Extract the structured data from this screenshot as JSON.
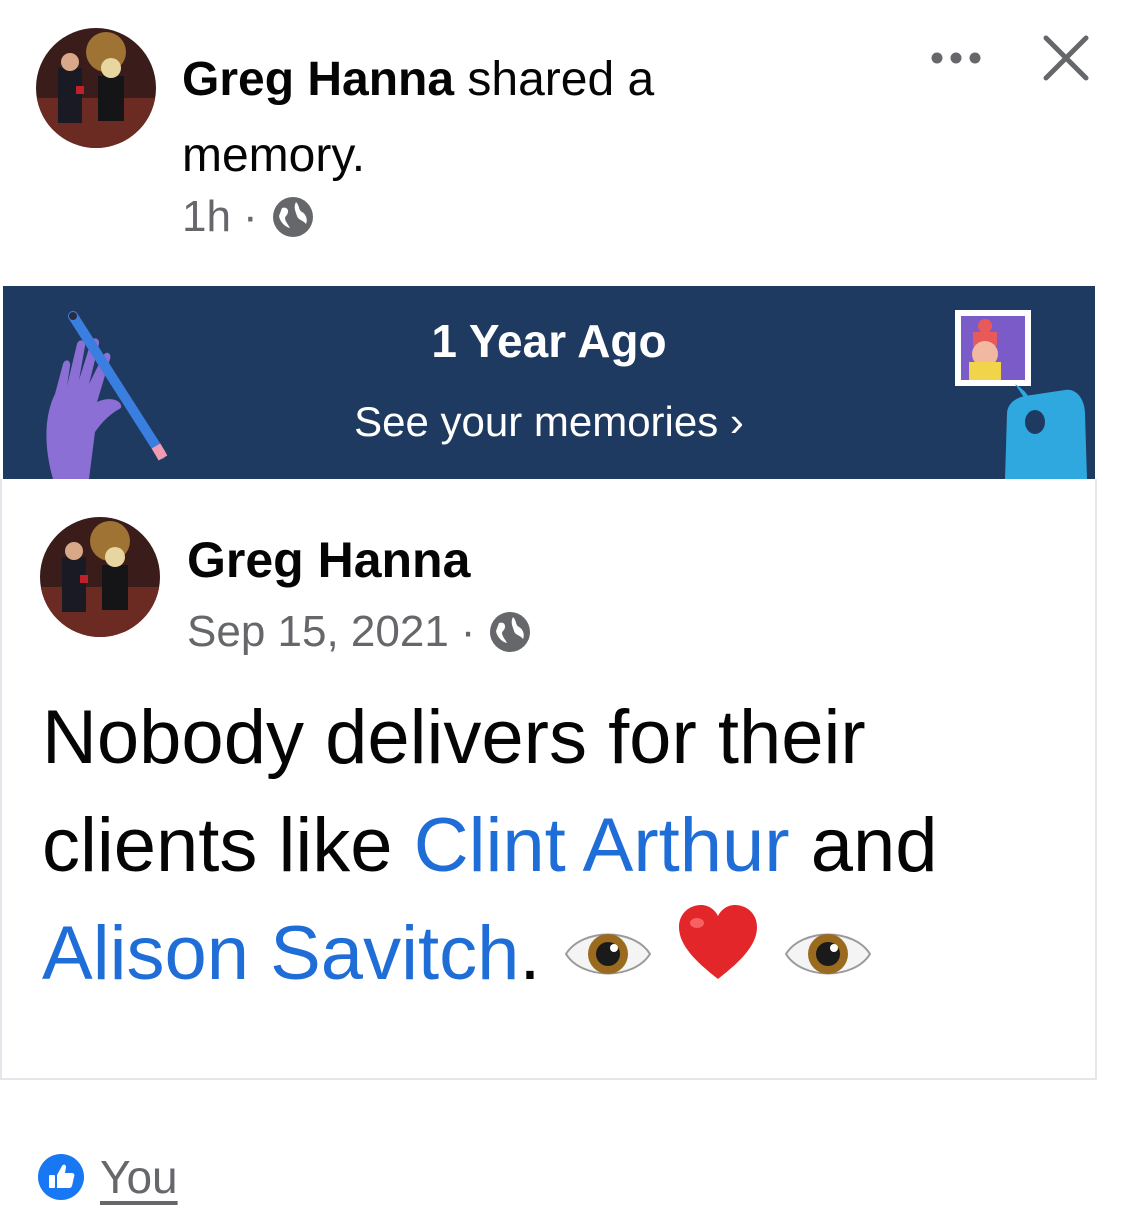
{
  "header": {
    "author": "Greg Hanna",
    "action": "shared a memory.",
    "time": "1h",
    "separator": "·",
    "privacy_icon": "globe-icon",
    "more_icon": "more-horizontal-icon",
    "close_icon": "close-icon"
  },
  "banner": {
    "title": "1 Year Ago",
    "link": "See your memories",
    "chevron": "›",
    "background": "#1f3a60"
  },
  "post": {
    "author": "Greg Hanna",
    "date": "Sep 15, 2021",
    "separator": "·",
    "privacy_icon": "globe-icon",
    "text_part1": "Nobody delivers for their clients like ",
    "mention1": "Clint Arthur",
    "text_part2": " and ",
    "mention2": "Alison Savitch",
    "text_part3": ".",
    "emojis": [
      "eye-emoji",
      "red-heart-emoji",
      "eye-emoji"
    ],
    "mention_color": "#1f6dd6"
  },
  "reactions": {
    "icon": "like-icon",
    "names": "You"
  }
}
